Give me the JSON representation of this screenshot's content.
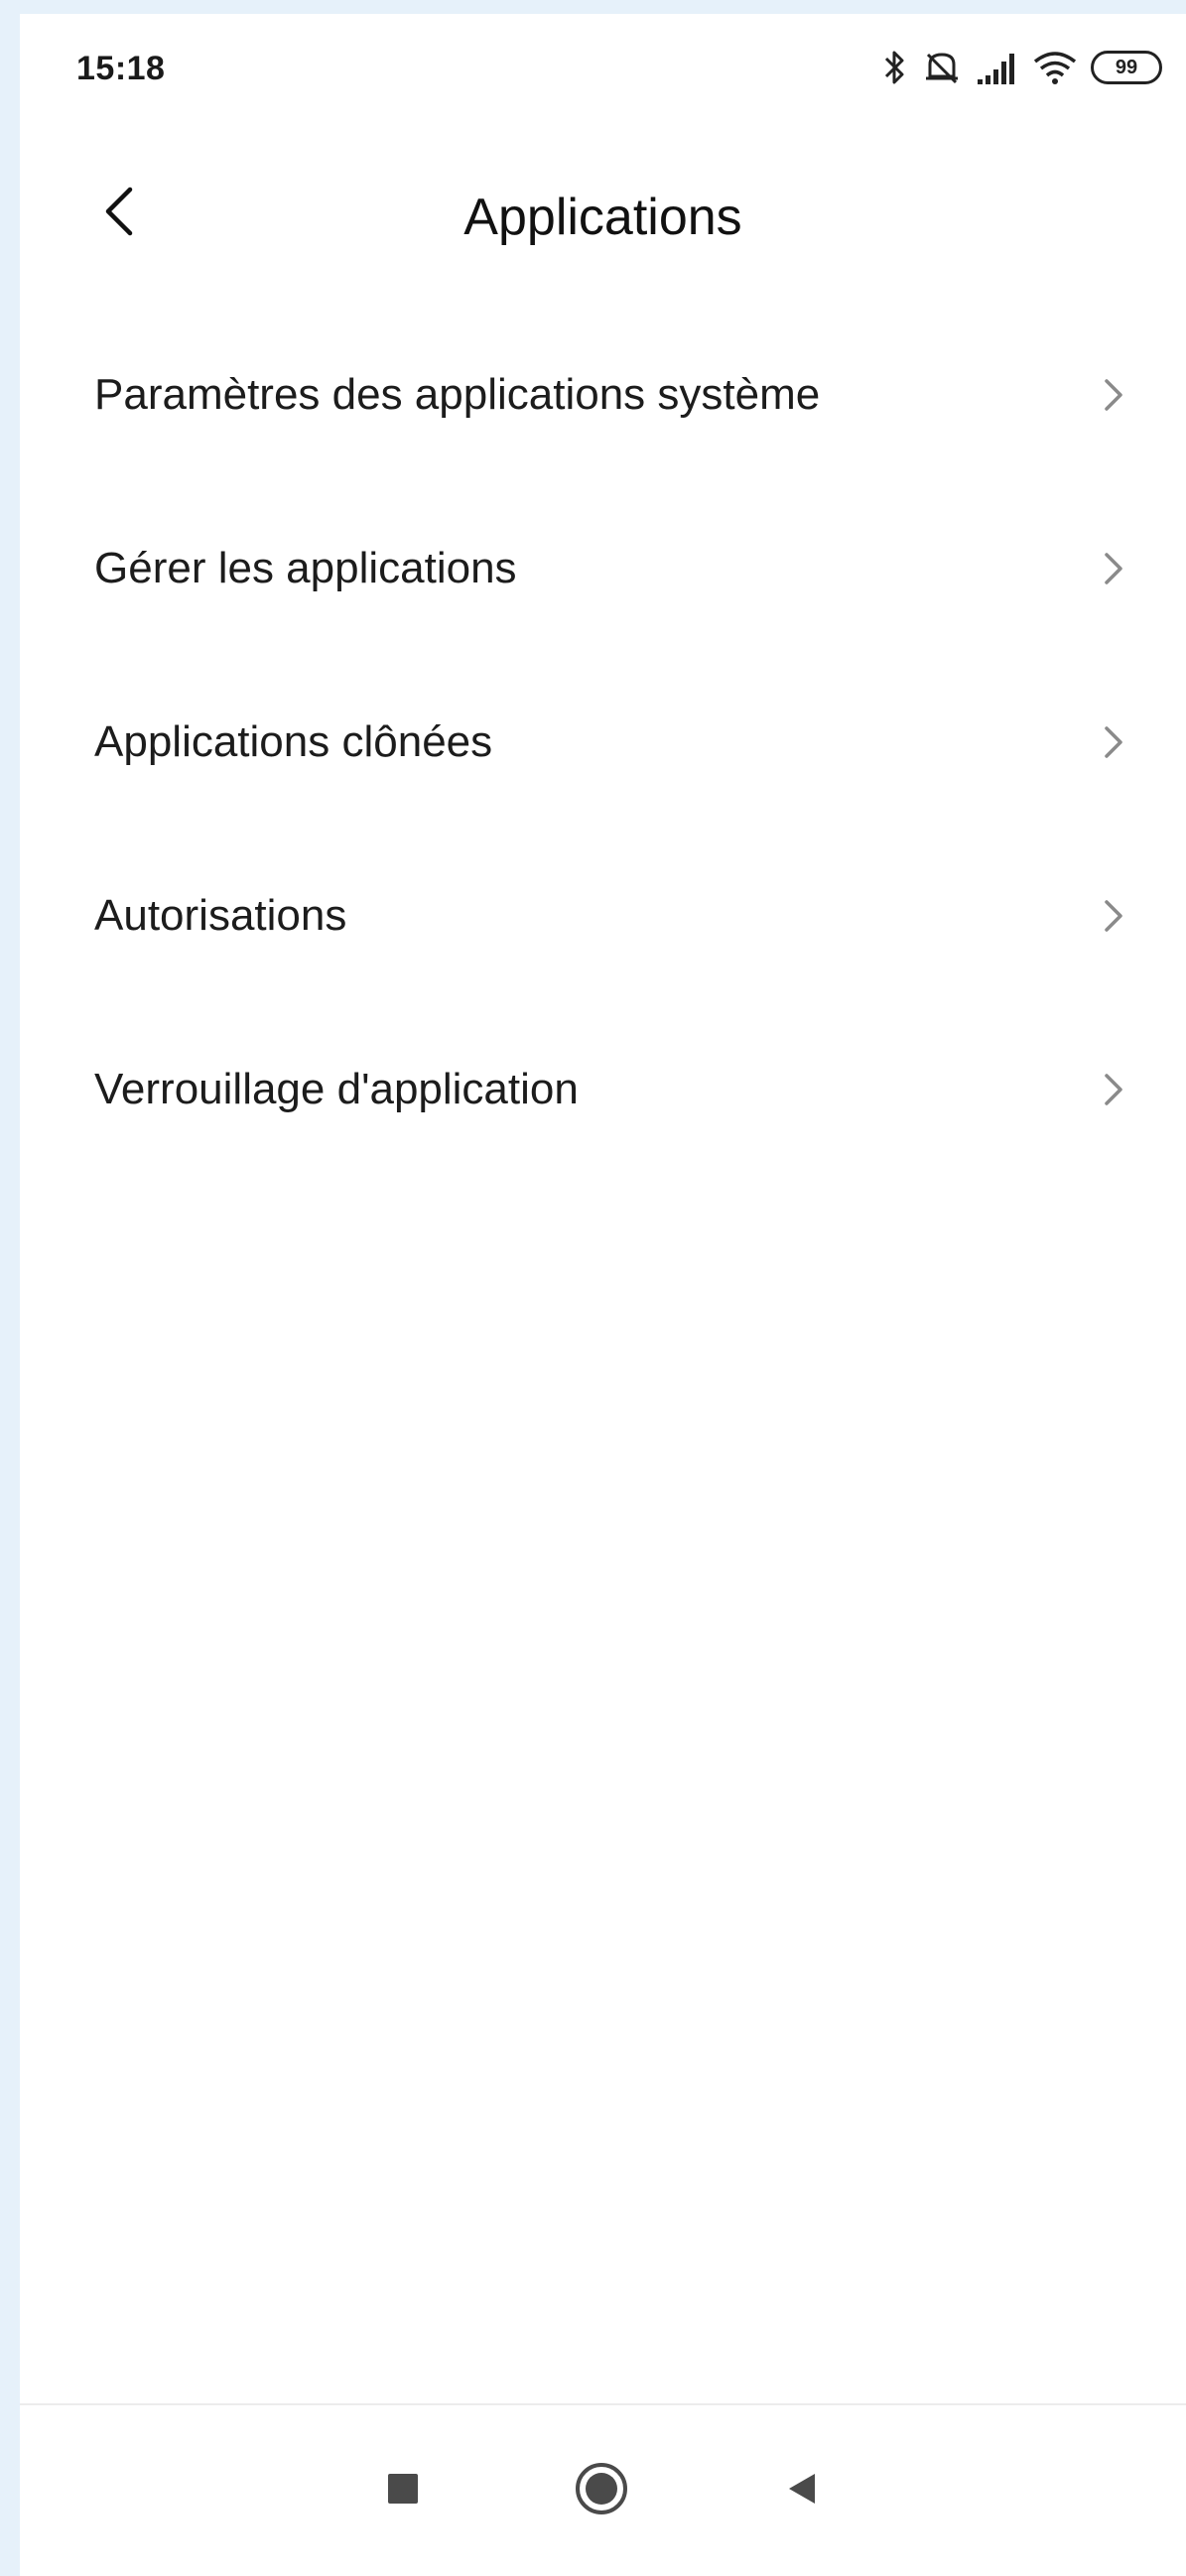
{
  "status_bar": {
    "time": "15:18",
    "battery_level": "99",
    "icons": [
      "bluetooth-icon",
      "mute-icon",
      "signal-icon",
      "wifi-icon",
      "battery-icon"
    ]
  },
  "header": {
    "title": "Applications",
    "back_icon": "chevron-left-icon"
  },
  "menu": {
    "items": [
      {
        "label": "Paramètres des applications système"
      },
      {
        "label": "Gérer les applications"
      },
      {
        "label": "Applications clônées"
      },
      {
        "label": "Autorisations"
      },
      {
        "label": "Verrouillage d'application"
      }
    ]
  },
  "nav_bar": {
    "icons": [
      "recents-icon",
      "home-icon",
      "back-triangle-icon"
    ]
  },
  "colors": {
    "background": "#ffffff",
    "outer_background": "#e6f1fa",
    "text": "#1c1c1c",
    "chevron": "#8a8a8a",
    "nav_icon": "#4a4a4a"
  }
}
